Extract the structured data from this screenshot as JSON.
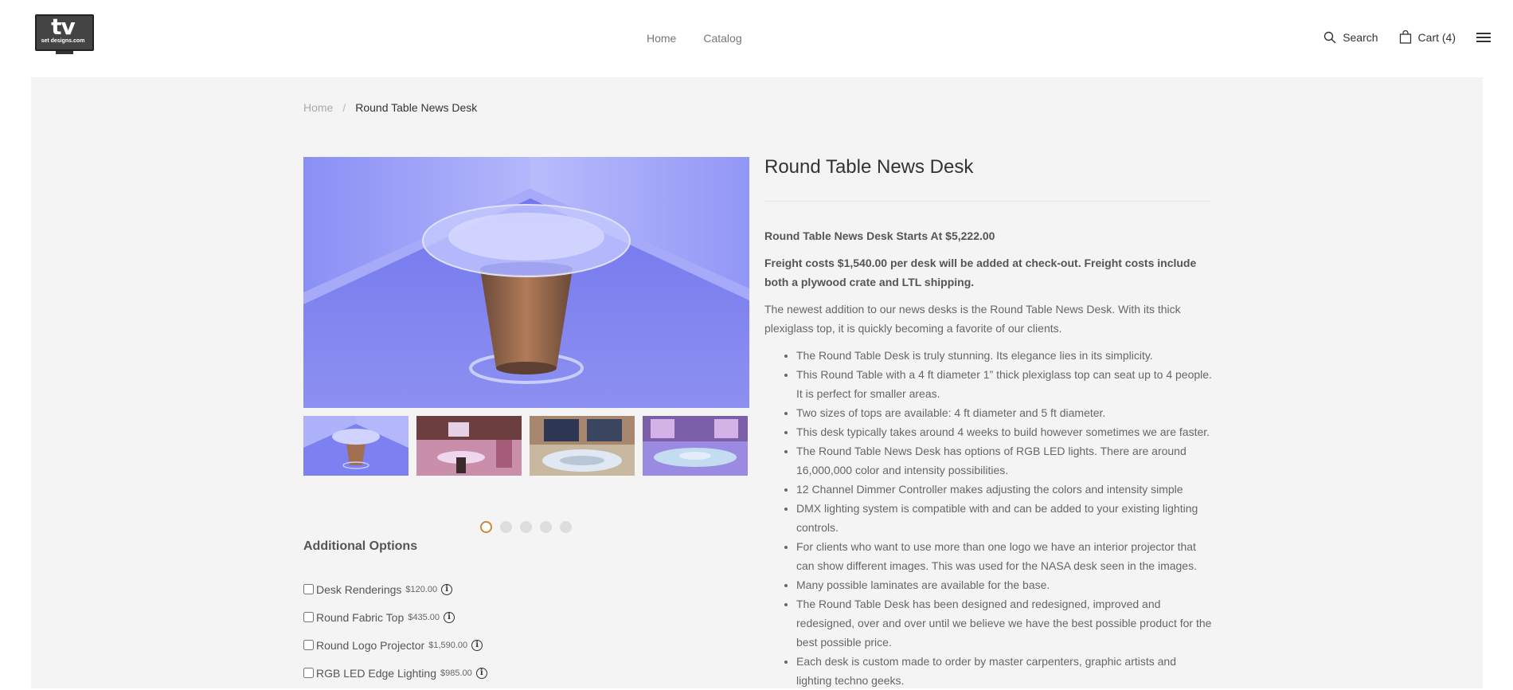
{
  "header": {
    "logo_text": "tv",
    "logo_sub": "set designs.com",
    "nav": [
      {
        "label": "Home"
      },
      {
        "label": "Catalog"
      }
    ],
    "search_label": "Search",
    "cart_label": "Cart (4)"
  },
  "breadcrumb": {
    "home": "Home",
    "separator": "/",
    "current": "Round Table News Desk"
  },
  "gallery": {
    "active_index": 0,
    "dot_count": 5,
    "accent_color": "#c9883b"
  },
  "options": {
    "title": "Additional Options",
    "items": [
      {
        "label": "Desk Renderings",
        "price": "$120.00"
      },
      {
        "label": "Round Fabric Top",
        "price": "$435.00"
      },
      {
        "label": "Round Logo Projector",
        "price": "$1,590.00"
      },
      {
        "label": "RGB LED Edge Lighting",
        "price": "$985.00"
      }
    ]
  },
  "product": {
    "title": "Round Table News Desk",
    "price_line": "Round Table News Desk Starts At $5,222.00",
    "freight_line": "Freight costs $1,540.00 per desk will be added at check-out. Freight costs include both a plywood crate and LTL shipping.",
    "intro": "The newest addition to our news desks is the Round Table News Desk. With its thick plexiglass top, it is quickly becoming a favorite of our clients.",
    "bullets": [
      "The Round Table Desk is truly stunning. Its elegance lies in its simplicity.",
      "This Round Table with a 4 ft diameter 1” thick plexiglass top can seat up to 4 people. It is perfect for smaller areas.",
      "Two sizes of tops are available: 4 ft diameter and 5 ft diameter.",
      "This desk typically takes around 4 weeks to build however sometimes we are faster.",
      "The Round Table News Desk has options of RGB LED lights. There are around 16,000,000 color and intensity possibilities.",
      "12 Channel Dimmer Controller makes adjusting the colors and intensity simple",
      "DMX lighting system is compatible with and can be added to your existing lighting controls.",
      "For clients who want to use more than one logo we have an interior projector that can show different images. This was used for the NASA  desk seen in the images.",
      "Many possible laminates are available for the base.",
      "The Round  Table Desk has been designed and redesigned, improved and redesigned, over and over until we believe we have the best possible product for the best possible price.",
      "Each desk is custom made to order by master carpenters, graphic artists and lighting techno geeks."
    ]
  }
}
